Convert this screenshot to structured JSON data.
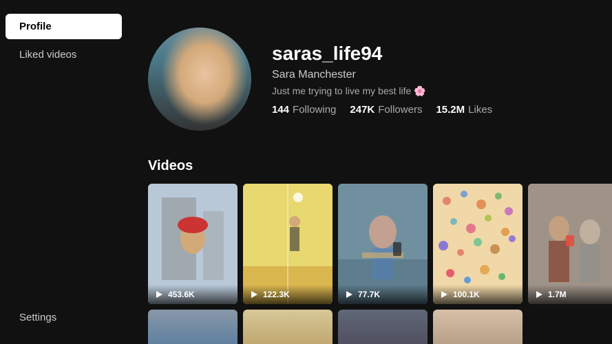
{
  "sidebar": {
    "items": [
      {
        "label": "Profile",
        "active": true
      },
      {
        "label": "Liked videos",
        "active": false
      },
      {
        "label": "Settings",
        "active": false
      }
    ]
  },
  "profile": {
    "username": "saras_life94",
    "display_name": "Sara Manchester",
    "bio": "Just me trying to live my best life 🌸",
    "stats": {
      "following": {
        "value": "144",
        "label": "Following"
      },
      "followers": {
        "value": "247K",
        "label": "Followers"
      },
      "likes": {
        "value": "15.2M",
        "label": "Likes"
      }
    }
  },
  "videos_section": {
    "title": "Videos",
    "items": [
      {
        "views": "453.6K",
        "thumb_class": "thumb-1"
      },
      {
        "views": "122.3K",
        "thumb_class": "thumb-2"
      },
      {
        "views": "77.7K",
        "thumb_class": "thumb-3"
      },
      {
        "views": "100.1K",
        "thumb_class": "thumb-4"
      },
      {
        "views": "1.7M",
        "thumb_class": "thumb-5"
      }
    ]
  }
}
